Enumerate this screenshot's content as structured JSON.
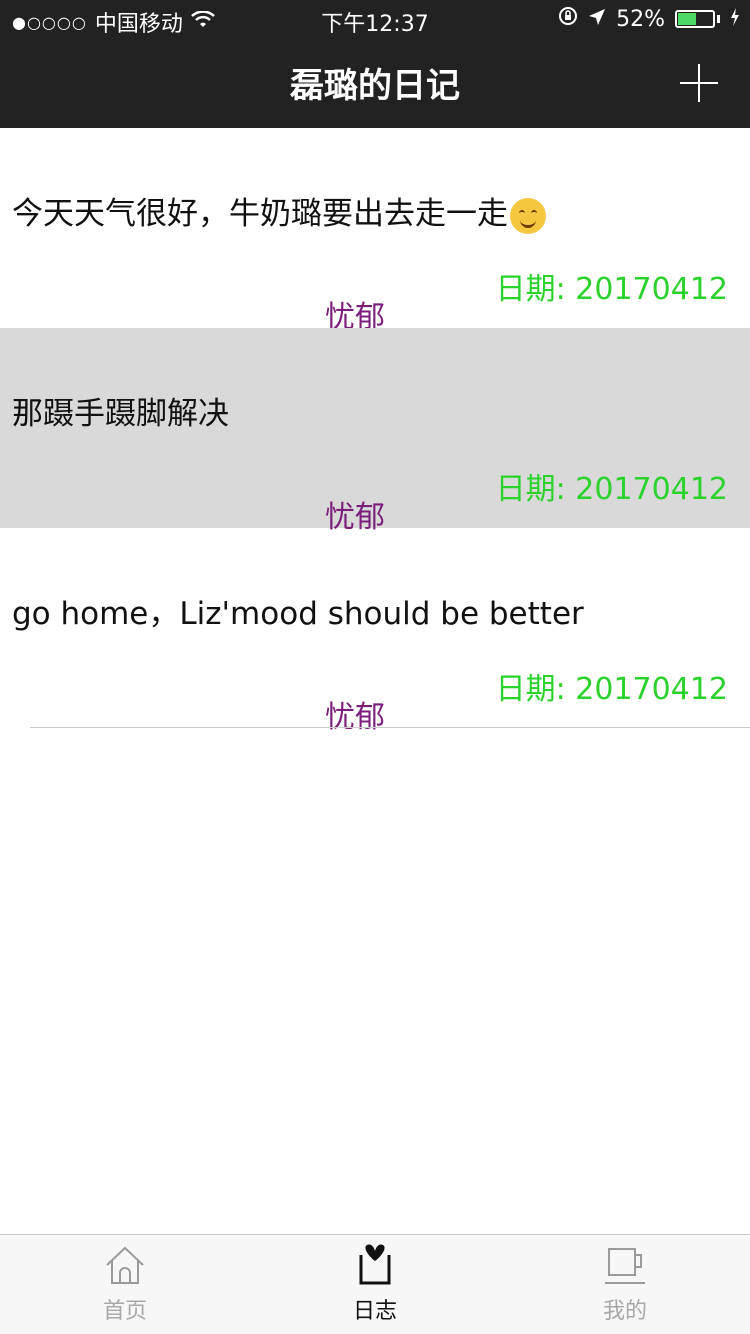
{
  "status_bar": {
    "signal_dots": "●○○○○",
    "carrier": "中国移动",
    "time": "下午12:37",
    "battery_text": "52%",
    "battery_level": 0.52
  },
  "nav": {
    "title": "磊璐的日记",
    "add_icon": "plus-icon"
  },
  "entries": [
    {
      "text": "今天天气很好，牛奶璐要出去走一走",
      "emoji": "smiling-face",
      "date": "日期: 20170412",
      "mood": "忧郁"
    },
    {
      "text": "那蹑手蹑脚解决",
      "date": "日期: 20170412",
      "mood": "忧郁"
    },
    {
      "text": "go home，Liz'mood should be better",
      "date": "日期: 20170412",
      "mood": "忧郁"
    }
  ],
  "colors": {
    "nav_bg": "#222222",
    "date": "#2bd22b",
    "mood": "#7a1f7a",
    "selected_row": "#d9d9d9"
  },
  "tabs": [
    {
      "label": "首页",
      "icon": "home-icon",
      "active": false
    },
    {
      "label": "日志",
      "icon": "diary-icon",
      "active": true
    },
    {
      "label": "我的",
      "icon": "cup-icon",
      "active": false
    }
  ]
}
